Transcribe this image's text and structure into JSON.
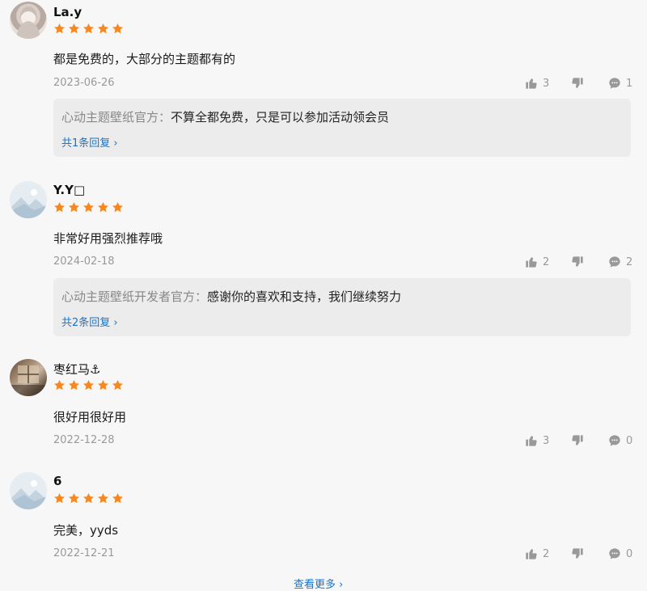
{
  "colors": {
    "star": "#f7871f",
    "link": "#1a73c8",
    "muted": "#999999",
    "reply_bg": "#ececec"
  },
  "reviews": [
    {
      "avatar_icon": "anime-girl-avatar",
      "name": "La.y",
      "rating": 5,
      "content": "都是免费的，大部分的主题都有的",
      "date": "2023-06-26",
      "likes": "3",
      "comments": "1",
      "reply": {
        "author": "心动主题壁纸官方：",
        "text": "不算全都免费，只是可以参加活动领会员",
        "link": "共1条回复 ›"
      }
    },
    {
      "avatar_icon": "mountain-avatar",
      "name": "Y.Y□",
      "rating": 5,
      "content": "非常好用强烈推荐哦",
      "date": "2024-02-18",
      "likes": "2",
      "comments": "2",
      "reply": {
        "author": "心动主题壁纸开发者官方：",
        "text": "感谢你的喜欢和支持，我们继续努力",
        "link": "共2条回复 ›"
      }
    },
    {
      "avatar_icon": "photo-avatar",
      "name": "枣红马⚓",
      "rating": 5,
      "content": "很好用很好用",
      "date": "2022-12-28",
      "likes": "3",
      "comments": "0"
    },
    {
      "avatar_icon": "mountain-avatar",
      "name": "6",
      "rating": 5,
      "content": "完美，yyds",
      "date": "2022-12-21",
      "likes": "2",
      "comments": "0"
    }
  ],
  "footer": {
    "more_label": "查看更多 ›"
  }
}
